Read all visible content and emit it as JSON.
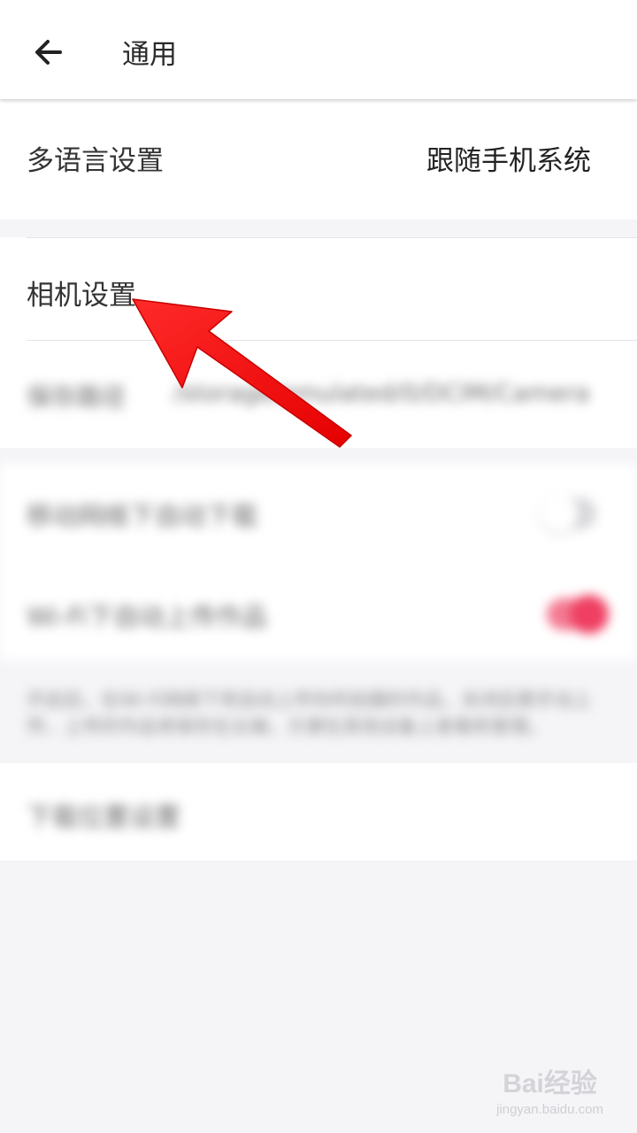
{
  "header": {
    "title": "通用"
  },
  "language": {
    "label": "多语言设置",
    "value": "跟随手机系统"
  },
  "camera": {
    "label": "相机设置",
    "path_label": "保存路径",
    "path_value": "/storage/emulated/0/DCIM/Camera"
  },
  "download": {
    "auto_download_label": "移动网络下自动下载",
    "auto_download_on": false,
    "wifi_upload_label": "Wi-Fi下自动上传作品",
    "wifi_upload_on": true,
    "note": "开启后，在Wi-Fi网络下将自动上传你所拍摄的作品，关闭后需手动上传，上传的作品将保存在云端，方便在其他设备上查看和管理。"
  },
  "misc": {
    "clear_cache_label": "下载位置设置"
  },
  "watermark": {
    "brand": "Bai经验",
    "url": "jingyan.baidu.com"
  },
  "colors": {
    "accent": "#ef3f62",
    "annotation_arrow": "#ff1a1a"
  }
}
